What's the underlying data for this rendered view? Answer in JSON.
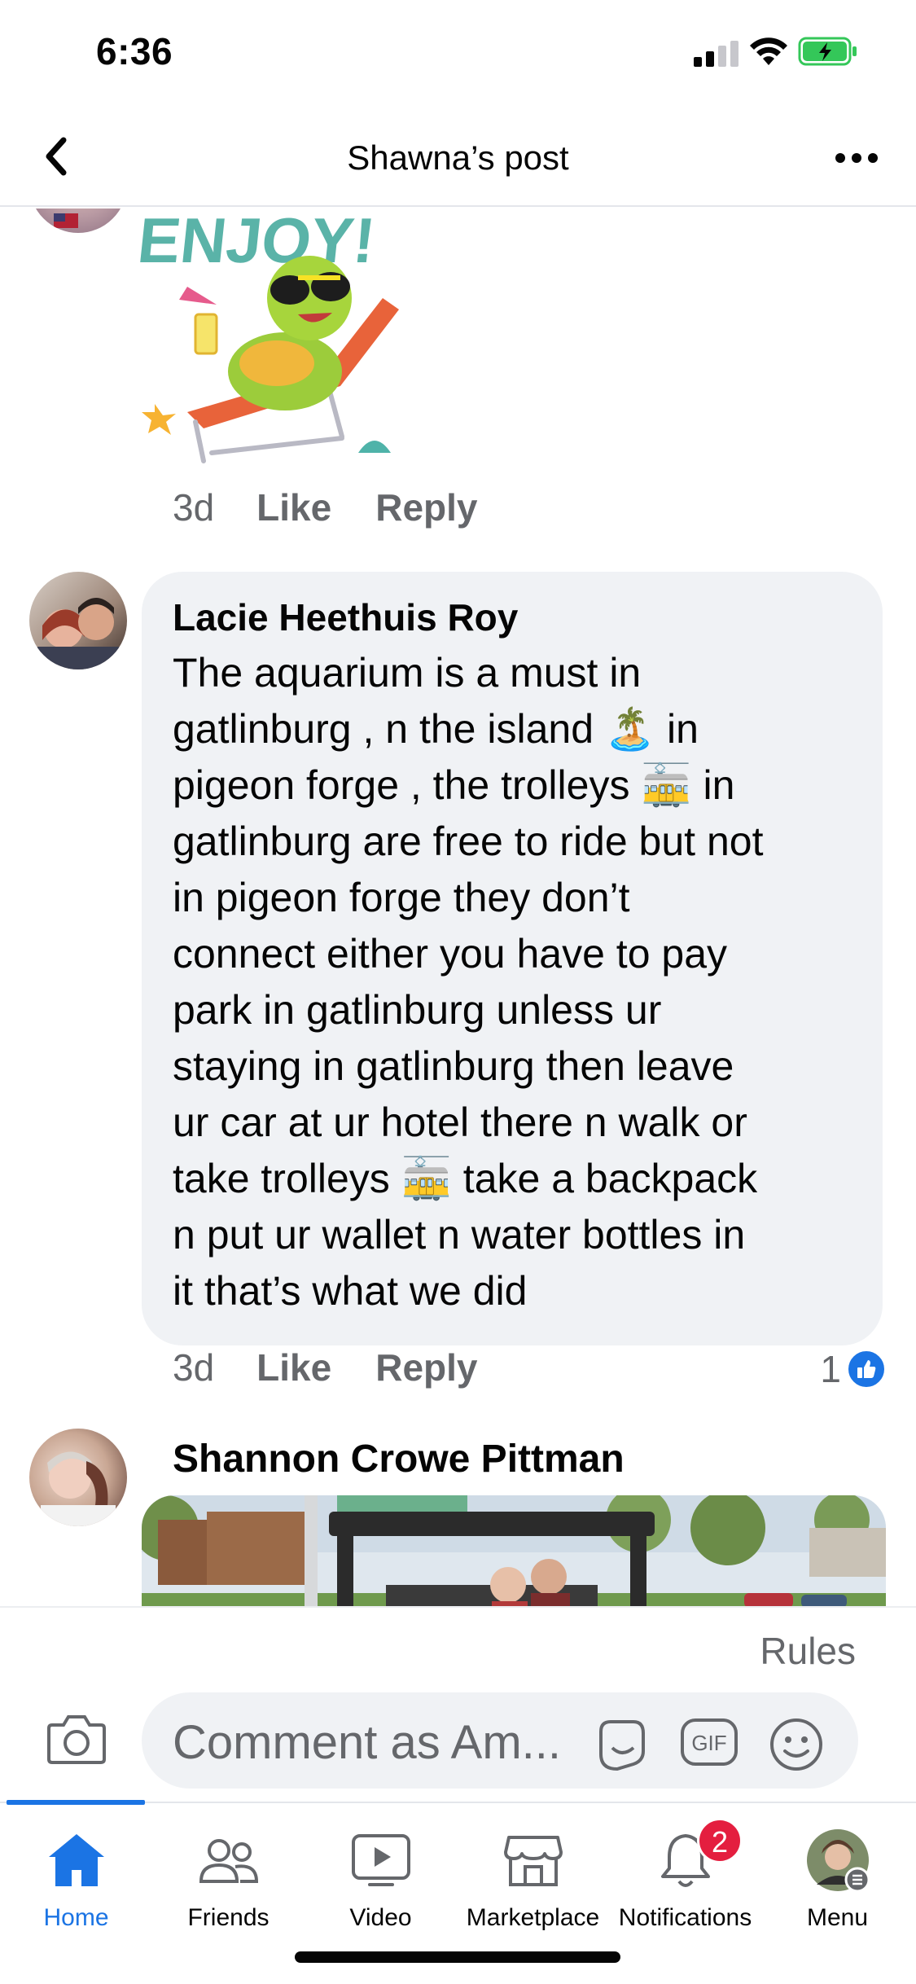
{
  "status_bar": {
    "time": "6:36"
  },
  "header": {
    "title": "Shawna’s post"
  },
  "comments": [
    {
      "time": "3d",
      "like_label": "Like",
      "reply_label": "Reply",
      "sticker_text": "ENJOY!"
    },
    {
      "author": "Lacie Heethuis Roy",
      "text": "The aquarium is a must in\ngatlinburg , n the island 🏝️ in\npigeon forge , the trolleys 🚋 in\ngatlinburg are free to ride but not\nin pigeon forge they don’t\nconnect either you have to pay\npark in gatlinburg unless ur\nstaying in gatlinburg then leave\nur car at ur hotel there n walk or\ntake trolleys 🚋 take a backpack\nn put ur wallet n water bottles in\nit that’s what we did",
      "time": "3d",
      "like_label": "Like",
      "reply_label": "Reply",
      "reaction_count": "1"
    },
    {
      "author": "Shannon Crowe Pittman"
    }
  ],
  "composer": {
    "rules_label": "Rules",
    "placeholder": "Comment as Am..."
  },
  "nav": {
    "items": [
      {
        "label": "Home",
        "icon": "home-icon"
      },
      {
        "label": "Friends",
        "icon": "friends-icon"
      },
      {
        "label": "Video",
        "icon": "video-icon"
      },
      {
        "label": "Marketplace",
        "icon": "marketplace-icon"
      },
      {
        "label": "Notifications",
        "icon": "bell-icon",
        "badge": "2"
      },
      {
        "label": "Menu",
        "icon": "profile-menu-icon"
      }
    ]
  },
  "colors": {
    "accent": "#1b74e4",
    "badge": "#e41e3f",
    "bubble": "#f0f2f5",
    "muted": "#65676b"
  }
}
